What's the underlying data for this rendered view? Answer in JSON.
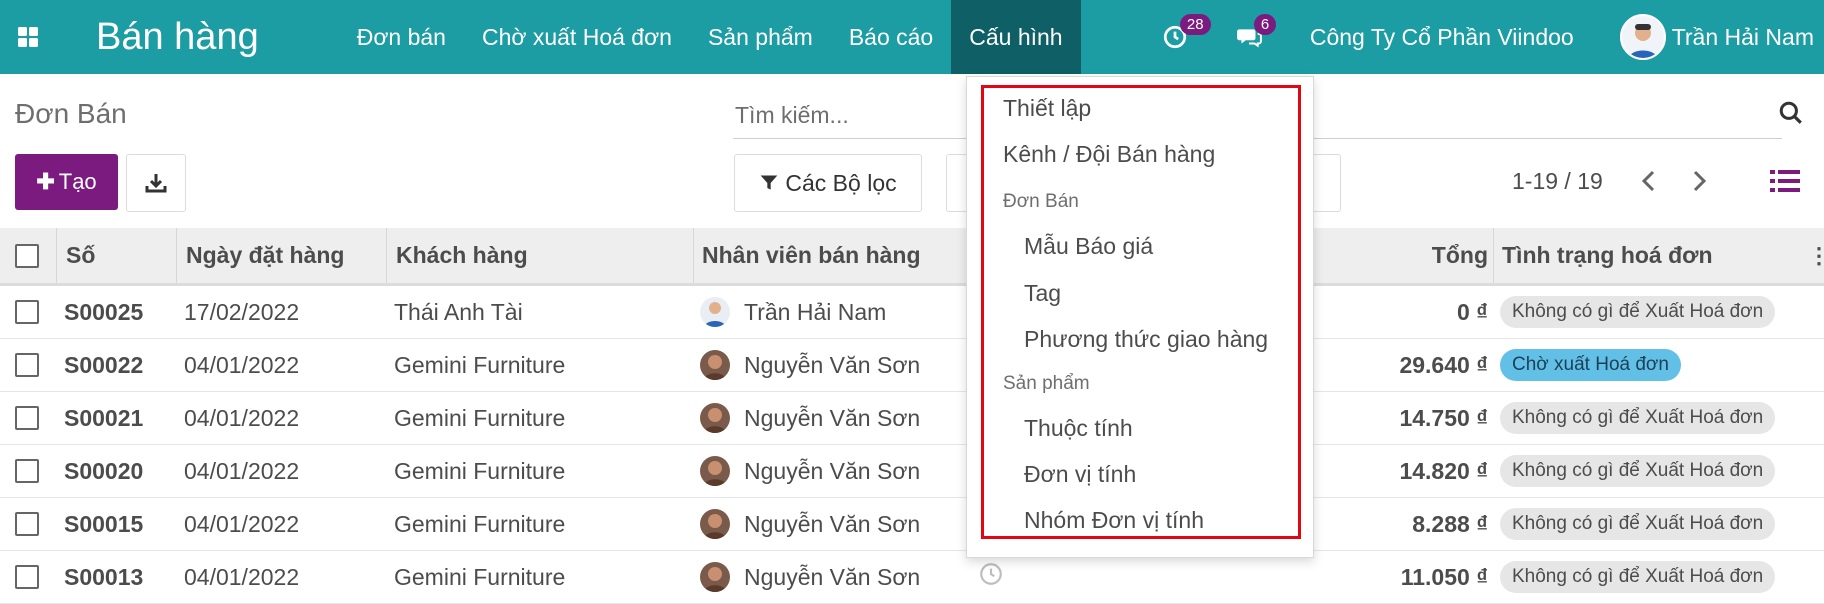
{
  "navbar": {
    "app_title": "Bán hàng",
    "menu": [
      "Đơn bán",
      "Chờ xuất Hoá đơn",
      "Sản phẩm",
      "Báo cáo",
      "Cấu hình"
    ],
    "active_menu": "Cấu hình",
    "activity_count": "28",
    "message_count": "6",
    "company": "Công Ty Cổ Phần Viindoo",
    "user": "Trần Hải Nam",
    "color": "#1c9ca3",
    "active_color": "#0e5f66",
    "badge_color": "#7b1b7f"
  },
  "control_panel": {
    "breadcrumb": "Đơn Bán",
    "create_label": "Tạo",
    "search_placeholder": "Tìm kiếm...",
    "filters_label": "Các Bộ lọc",
    "pager": "1-19 / 19"
  },
  "table": {
    "columns": [
      "Số",
      "Ngày đặt hàng",
      "Khách hàng",
      "Nhân viên bán hàng",
      "Tổng",
      "Tình trạng hoá đơn"
    ],
    "rows": [
      {
        "number": "S00025",
        "date": "17/02/2022",
        "customer": "Thái Anh Tài",
        "salesperson": "Trần Hải Nam",
        "total": "0 ₫",
        "status": "Không có gì để Xuất Hoá đơn"
      },
      {
        "number": "S00022",
        "date": "04/01/2022",
        "customer": "Gemini Furniture",
        "salesperson": "Nguyễn Văn Sơn",
        "total": "29.640 ₫",
        "status": "Chờ xuất Hoá đơn"
      },
      {
        "number": "S00021",
        "date": "04/01/2022",
        "customer": "Gemini Furniture",
        "salesperson": "Nguyễn Văn Sơn",
        "total": "14.750 ₫",
        "status": "Không có gì để Xuất Hoá đơn"
      },
      {
        "number": "S00020",
        "date": "04/01/2022",
        "customer": "Gemini Furniture",
        "salesperson": "Nguyễn Văn Sơn",
        "total": "14.820 ₫",
        "status": "Không có gì để Xuất Hoá đơn"
      },
      {
        "number": "S00015",
        "date": "04/01/2022",
        "customer": "Gemini Furniture",
        "salesperson": "Nguyễn Văn Sơn",
        "total": "8.288 ₫",
        "status": "Không có gì để Xuất Hoá đơn"
      },
      {
        "number": "S00013",
        "date": "04/01/2022",
        "customer": "Gemini Furniture",
        "salesperson": "Nguyễn Văn Sơn",
        "total": "11.050 ₫",
        "status": "Không có gì để Xuất Hoá đơn"
      }
    ]
  },
  "dropdown": {
    "items": [
      {
        "type": "item",
        "label": "Thiết lập"
      },
      {
        "type": "item",
        "label": "Kênh / Đội Bán hàng"
      },
      {
        "type": "header",
        "label": "Đơn Bán"
      },
      {
        "type": "subitem",
        "label": "Mẫu Báo giá"
      },
      {
        "type": "subitem",
        "label": "Tag"
      },
      {
        "type": "subitem",
        "label": "Phương thức giao hàng"
      },
      {
        "type": "header",
        "label": "Sản phẩm"
      },
      {
        "type": "subitem",
        "label": "Thuộc tính"
      },
      {
        "type": "subitem",
        "label": "Đơn vị tính"
      },
      {
        "type": "subitem",
        "label": "Nhóm Đơn vị tính"
      }
    ],
    "highlight_color": "#e30613"
  }
}
